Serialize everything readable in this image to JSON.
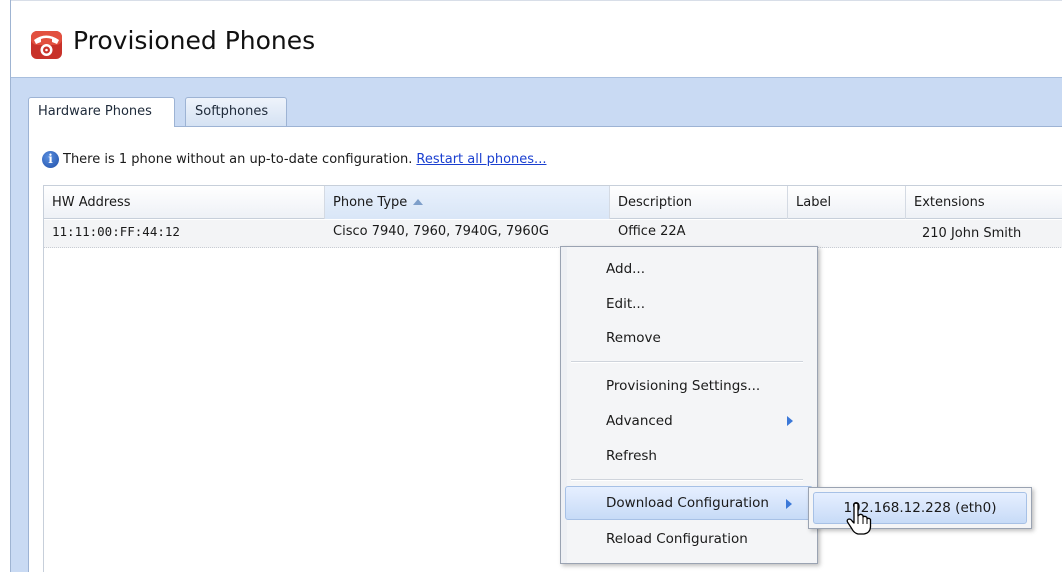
{
  "header": {
    "title": "Provisioned Phones",
    "icon": "red-telephone-icon"
  },
  "tabs": [
    {
      "label": "Hardware Phones",
      "active": true
    },
    {
      "label": "Softphones",
      "active": false
    }
  ],
  "info": {
    "icon": "info-icon",
    "message": "There is 1 phone without an up-to-date configuration.",
    "link": "Restart all phones..."
  },
  "grid": {
    "columns": [
      {
        "label": "HW Address"
      },
      {
        "label": "Phone Type",
        "sorted": "ascending"
      },
      {
        "label": "Description"
      },
      {
        "label": "Label"
      },
      {
        "label": "Extensions"
      }
    ],
    "rows": [
      {
        "hw_address": "11:11:00:FF:44:12",
        "phone_type": "Cisco 7940, 7960, 7940G, 7960G",
        "description": "Office 22A",
        "label": "",
        "extensions": "210 John Smith"
      }
    ]
  },
  "context_menu": {
    "items": [
      "Add...",
      "Edit...",
      "Remove",
      "Provisioning Settings...",
      "Advanced",
      "Refresh",
      "Download Configuration",
      "Reload Configuration"
    ]
  },
  "submenu": {
    "item": "192.168.12.228 (eth0)"
  },
  "colors": {
    "panel": "#c9daf3",
    "highlight": "#c7dbf7",
    "link": "#1a3fd0",
    "icon_red": "#d23a2a"
  }
}
